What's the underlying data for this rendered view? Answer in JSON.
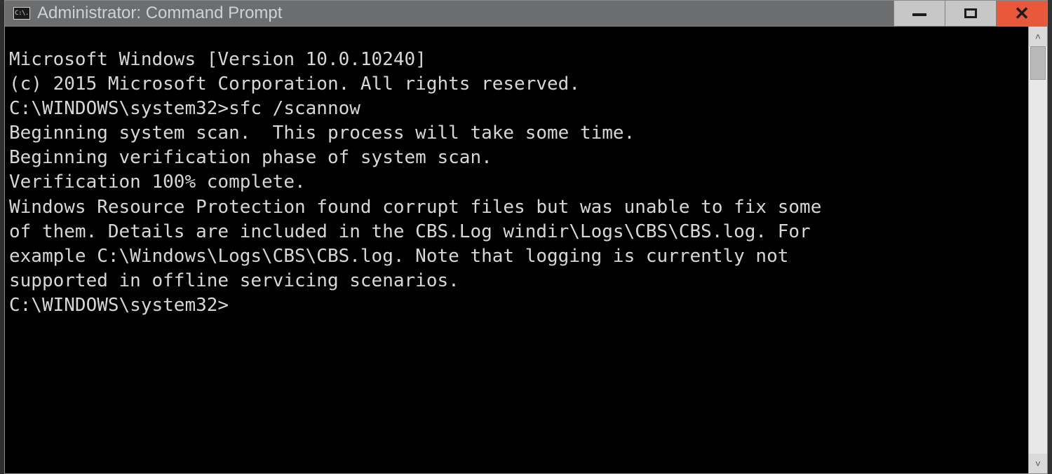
{
  "window": {
    "title": "Administrator: Command Prompt",
    "icon_glyph": "C:\\."
  },
  "controls": {
    "minimize_name": "minimize-button",
    "maximize_name": "maximize-button",
    "close_name": "close-button",
    "close_glyph": "✕"
  },
  "scrollbar": {
    "up_glyph": "˄",
    "down_glyph": "˅"
  },
  "console": {
    "lines": [
      "Microsoft Windows [Version 10.0.10240]",
      "(c) 2015 Microsoft Corporation. All rights reserved.",
      "",
      "C:\\WINDOWS\\system32>sfc /scannow",
      "",
      "Beginning system scan.  This process will take some time.",
      "",
      "Beginning verification phase of system scan.",
      "Verification 100% complete.",
      "",
      "Windows Resource Protection found corrupt files but was unable to fix some",
      "of them. Details are included in the CBS.Log windir\\Logs\\CBS\\CBS.log. For",
      "example C:\\Windows\\Logs\\CBS\\CBS.log. Note that logging is currently not",
      "supported in offline servicing scenarios.",
      "",
      "C:\\WINDOWS\\system32>"
    ]
  }
}
